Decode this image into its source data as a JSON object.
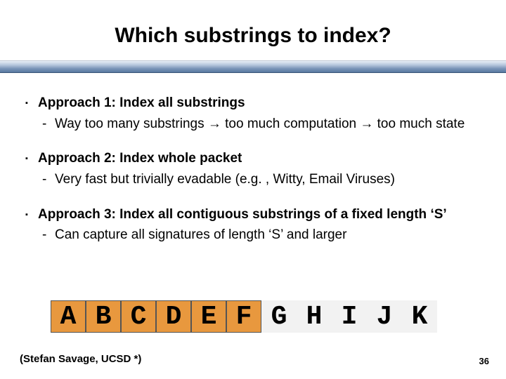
{
  "title": "Which substrings to index?",
  "bullets": [
    {
      "head": "Approach 1: Index all substrings",
      "sub": "Way too many substrings → too much computation → too much state"
    },
    {
      "head": "Approach 2: Index whole packet",
      "sub": "Very fast but trivially evadable (e.g. , Witty, Email Viruses)"
    },
    {
      "head": "Approach 3: Index all contiguous substrings of a fixed length ‘S’",
      "sub": "Can capture all signatures of length ‘S’ and larger"
    }
  ],
  "letters": [
    {
      "char": "A",
      "hl": true
    },
    {
      "char": "B",
      "hl": true
    },
    {
      "char": "C",
      "hl": true
    },
    {
      "char": "D",
      "hl": true
    },
    {
      "char": "E",
      "hl": true
    },
    {
      "char": "F",
      "hl": true
    },
    {
      "char": "G",
      "hl": false
    },
    {
      "char": "H",
      "hl": false
    },
    {
      "char": "I",
      "hl": false
    },
    {
      "char": "J",
      "hl": false
    },
    {
      "char": "K",
      "hl": false
    }
  ],
  "footer_left": "(Stefan Savage, UCSD *)",
  "page_number": "36",
  "markers": {
    "b1": "▪",
    "sub": "-"
  }
}
